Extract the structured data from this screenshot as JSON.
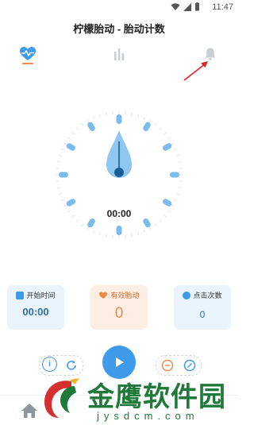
{
  "status_bar": {
    "time": "11:47"
  },
  "header": {
    "title": "柠檬胎动 - 胎动计数"
  },
  "tabs": [
    {
      "name": "heartbeat",
      "icon": "heart-pulse-icon",
      "active": true
    },
    {
      "name": "stats",
      "icon": "bar-chart-icon",
      "active": false
    },
    {
      "name": "reminder",
      "icon": "bell-icon",
      "active": false
    }
  ],
  "timer": {
    "display": "00:00"
  },
  "cards": {
    "start": {
      "label": "开始时间",
      "value": "00:00",
      "icon": "calendar-icon"
    },
    "effective": {
      "label": "有效胎动",
      "value": "0",
      "icon": "heart-pulse-icon"
    },
    "taps": {
      "label": "点击次数",
      "value": "0",
      "icon": "check-badge-icon"
    }
  },
  "controls": {
    "left": [
      "info-icon",
      "refresh-icon"
    ],
    "right": [
      "minus-icon",
      "edit-icon"
    ],
    "center": "play-icon"
  },
  "watermark": {
    "brand": "金鹰软件园",
    "url": "jysdcm.com"
  },
  "colors": {
    "accent": "#3d9be9",
    "orange": "#f08a4b",
    "card_blue_bg": "#e9f4fd",
    "card_orange_bg": "#fdeee4",
    "watermark_green": "#1f7a3a"
  }
}
